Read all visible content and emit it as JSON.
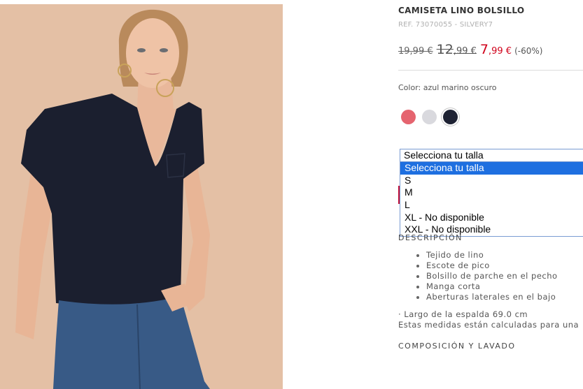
{
  "product": {
    "title": "CAMISETA LINO BOLSILLO",
    "ref": "REF. 73070055 - SILVERY7",
    "prices": {
      "original": "19,99 €",
      "previous_int": "12",
      "previous_dec": ",99 €",
      "current_int": "7",
      "current_dec": ",99 €",
      "discount": "(-60%)"
    },
    "color_label": "Color: azul marino oscuro",
    "swatches": [
      {
        "name": "coral",
        "color": "#e5646f"
      },
      {
        "name": "light-grey",
        "color": "#d9d9de"
      },
      {
        "name": "navy",
        "color": "#1e2233",
        "selected": true
      }
    ]
  },
  "size_select": {
    "value": "Selecciona tu talla",
    "options": [
      "Selecciona tu talla",
      "S",
      "M",
      "L",
      "XL - No disponible",
      "XXL - No disponible"
    ],
    "highlighted_index": 0
  },
  "description": {
    "heading": "DESCRIPCIÓN",
    "bullets": [
      "Tejido de lino",
      "Escote de pico",
      "Bolsillo de parche en el pecho",
      "Manga corta",
      "Aberturas laterales en el bajo"
    ],
    "measure_line1": "· Largo de la espalda 69.0 cm",
    "measure_line2": "Estas medidas están calculadas para una"
  },
  "composition": {
    "heading": "COMPOSICIÓN Y LAVADO"
  },
  "colors": {
    "sale_red": "#d0021b",
    "select_highlight": "#1e6fe0",
    "photo_background": "#e4c0a5"
  }
}
